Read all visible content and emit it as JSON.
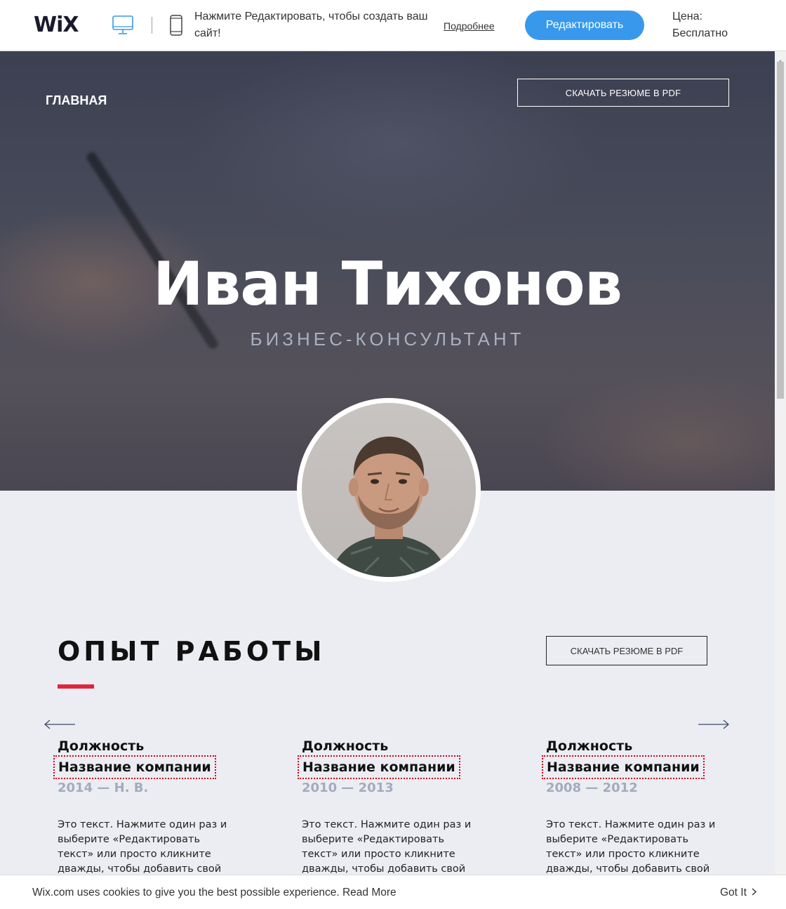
{
  "wix_bar": {
    "logo": "WiX",
    "message": "Нажмите Редактировать, чтобы создать ваш сайт!",
    "more_link": "Подробнее",
    "edit_button": "Редактировать",
    "price": "Цена: Бесплатно",
    "accent_color": "#3899ec"
  },
  "hero": {
    "nav_home": "ГЛАВНАЯ",
    "download_button": "СКАЧАТЬ РЕЗЮМЕ В PDF",
    "name": "Иван Тихонов",
    "subtitle": "БИЗНЕС-КОНСУЛЬТАНТ"
  },
  "experience": {
    "title": "ОПЫТ РАБОТЫ",
    "download_button": "СКАЧАТЬ РЕЗЮМЕ В PDF",
    "accent_color": "#e0253f",
    "jobs": [
      {
        "position": "Должность",
        "company": "Название компании",
        "years": "2014 — Н. В.",
        "text": "Это текст. Нажмите один раз и выберите «Редактировать текст» или просто кликните дважды, чтобы добавить свой текст."
      },
      {
        "position": "Должность",
        "company": "Название компании",
        "years": "2010 — 2013",
        "text": "Это текст. Нажмите один раз и выберите «Редактировать текст» или просто кликните дважды, чтобы добавить свой текст."
      },
      {
        "position": "Должность",
        "company": "Название компании",
        "years": "2008 — 2012",
        "text": "Это текст. Нажмите один раз и выберите «Редактировать текст» или просто кликните дважды, чтобы добавить свой текст."
      }
    ]
  },
  "cookie_bar": {
    "text": "Wix.com uses cookies to give you the best possible experience.",
    "read_more": "Read More",
    "got_it": "Got It"
  },
  "icons": [
    "desktop-icon",
    "mobile-icon",
    "arrow-left-icon",
    "arrow-right-icon",
    "chevron-right-icon",
    "scroll-up-icon"
  ]
}
